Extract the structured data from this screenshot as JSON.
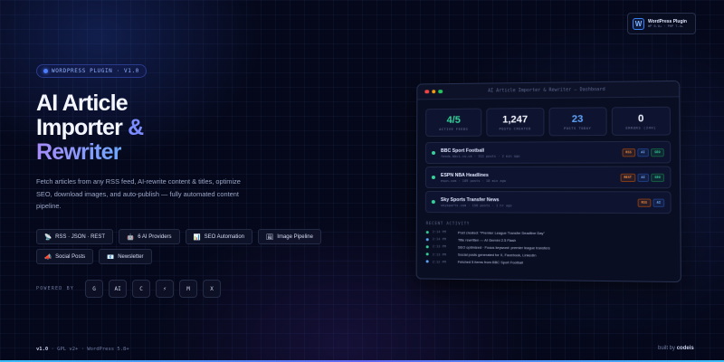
{
  "badge": {
    "title": "WordPress Plugin",
    "meta": "WP 6.0+ · PHP 7.4+",
    "logo": "W"
  },
  "hero": {
    "tag": "WORDPRESS PLUGIN · V1.0",
    "title_line1": "AI Article",
    "title_line2": "Importer",
    "title_amp": "&",
    "title_line3": "Rewriter",
    "description": "Fetch articles from any RSS feed, AI-rewrite content & titles, optimize SEO, download images, and auto-publish — fully automated content pipeline."
  },
  "features": [
    {
      "icon": "rss-icon",
      "glyph": "📡",
      "label": "RSS · JSON · REST"
    },
    {
      "icon": "robot-icon",
      "glyph": "🤖",
      "label": "6 AI Providers"
    },
    {
      "icon": "chart-icon",
      "glyph": "📊",
      "label": "SEO Automation"
    },
    {
      "icon": "image-icon",
      "glyph": "🖼",
      "label": "Image Pipeline"
    },
    {
      "icon": "megaphone-icon",
      "glyph": "📣",
      "label": "Social Posts"
    },
    {
      "icon": "mail-icon",
      "glyph": "📧",
      "label": "Newsletter"
    }
  ],
  "powered": {
    "label": "POWERED BY",
    "badges": [
      "G",
      "AI",
      "C",
      "⚡",
      "M",
      "X"
    ]
  },
  "footer": {
    "version": "v1.0",
    "license": " · GPL v2+ · WordPress 5.8+",
    "built_prefix": "built by",
    "built_name": "codeis"
  },
  "dashboard": {
    "title": "AI Article Importer & Rewriter — Dashboard",
    "stats": [
      {
        "value": "4/5",
        "label": "ACTIVE FEEDS",
        "color": "#34d399"
      },
      {
        "value": "1,247",
        "label": "POSTS CREATED",
        "color": "#f4f6ff"
      },
      {
        "value": "23",
        "label": "POSTS TODAY",
        "color": "#60a5fa"
      },
      {
        "value": "0",
        "label": "ERRORS (24H)",
        "color": "#f4f6ff"
      }
    ],
    "feeds": [
      {
        "name": "BBC Sport Football",
        "meta": "feeds.bbci.co.uk · 312 posts · 2 min ago",
        "tags": [
          "RSS",
          "AI",
          "SEO"
        ]
      },
      {
        "name": "ESPN NBA Headlines",
        "meta": "espn.com · 189 posts · 18 min ago",
        "tags": [
          "REST",
          "AI",
          "SEO"
        ]
      },
      {
        "name": "Sky Sports Transfer News",
        "meta": "skysports.com · 156 posts · 1 hr ago",
        "tags": [
          "RSS",
          "AI"
        ]
      }
    ],
    "activity_title": "RECENT ACTIVITY",
    "activity": [
      {
        "time": "2:14 PM",
        "text": "Post created: \"Premier League Transfer Deadline Day\"",
        "color": "#34d399"
      },
      {
        "time": "2:14 PM",
        "text": "Title rewritten — AI Gemini 2.5 Flash",
        "color": "#60a5fa"
      },
      {
        "time": "2:13 PM",
        "text": "SEO optimized · Focus keyword: premier league transfers",
        "color": "#34d399"
      },
      {
        "time": "2:13 PM",
        "text": "Social posts generated for X, Facebook, LinkedIn",
        "color": "#34d399"
      },
      {
        "time": "2:12 PM",
        "text": "Fetched 5 items from BBC Sport Football",
        "color": "#60a5fa"
      }
    ]
  }
}
